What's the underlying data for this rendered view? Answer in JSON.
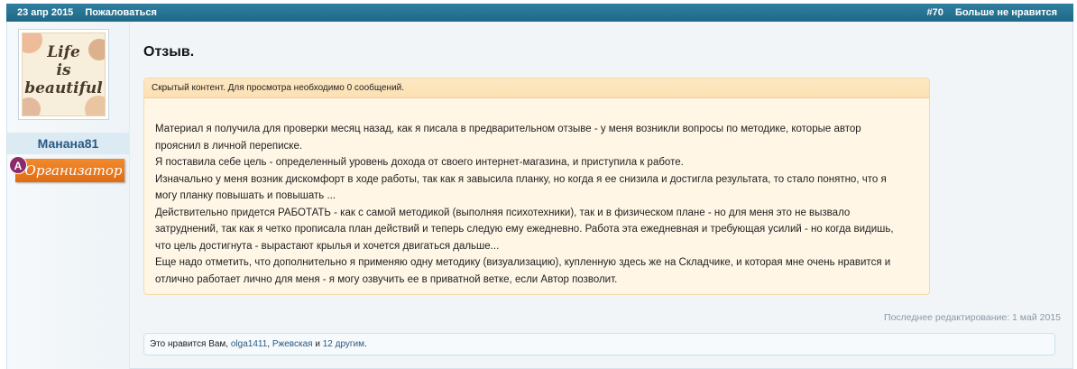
{
  "header": {
    "date": "23 апр 2015",
    "report": "Пожаловаться",
    "post_number": "#70",
    "unlike": "Больше не нравится"
  },
  "user": {
    "avatar_lines": [
      "Life",
      "is",
      "beautiful"
    ],
    "name": "Манана81",
    "role_letter": "А",
    "role": "Организатор"
  },
  "post": {
    "title": "Отзыв.",
    "hidden_notice": "Скрытый контент. Для просмотра необходимо 0 сообщений.",
    "body": [
      "Материал я получила для проверки месяц назад, как я писала в предварительном отзыве - у меня возникли вопросы по методике, которые автор прояснил в личной переписке.",
      "Я поставила себе цель - определенный уровень дохода от своего интернет-магазина, и приступила к работе.",
      "Изначально у меня возник дискомфорт в ходе работы, так как я завысила планку, но когда я ее снизила и достигла результата, то стало понятно, что я могу планку повышать и повышать ...",
      "Действительно придется РАБОТАТЬ - как с самой методикой (выполняя психотехники), так и в физическом плане - но для меня это не вызвало затруднений, так как я четко прописала план действий и теперь следую ему ежедневно. Работа эта ежедневная и требующая усилий - но когда видишь, что цель достигнута - вырастают крылья и хочется двигаться дальше...",
      "Еще надо отметить, что дополнительно я применяю одну методику (визуализацию), купленную здесь же на Складчике, и которая мне очень нравится и отлично работает лично для меня - я могу озвучить ее в приватной ветке, если Автор позволит."
    ],
    "edited": "Последнее редактирование: 1 май 2015"
  },
  "likes": {
    "prefix": "Это нравится Вам,",
    "user1": "olga1411",
    "sep": ",",
    "user2": "Ржевская",
    "and": "и",
    "others": "12 другим",
    "end": "."
  },
  "colors": {
    "header_bar": "#2378a0",
    "accent_link": "#2a5a82",
    "role_badge": "#e8761c",
    "hidden_box": "#fff6e6"
  }
}
